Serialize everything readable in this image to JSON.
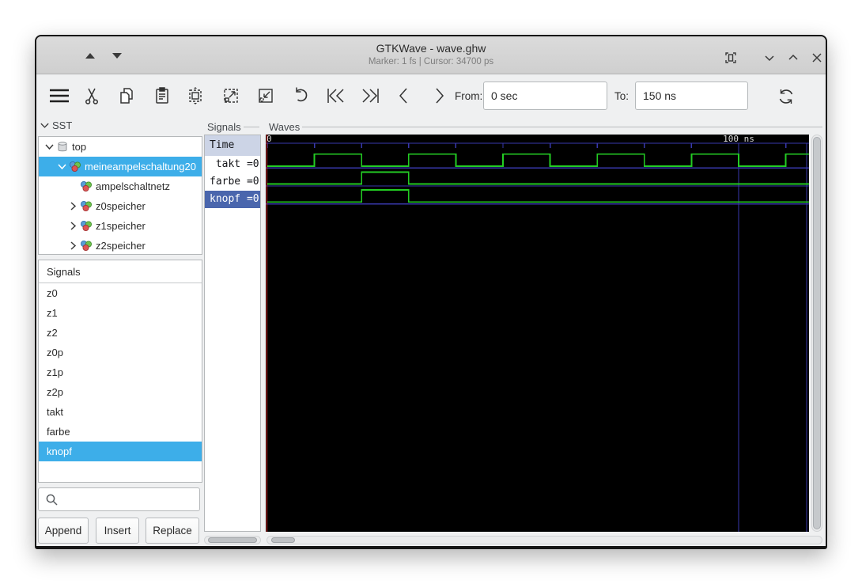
{
  "window": {
    "title": "GTKWave - wave.ghw",
    "status": "Marker: 1 fs  |  Cursor: 34700 ps"
  },
  "toolbar": {
    "from_label": "From:",
    "from_value": "0 sec",
    "to_label": "To:",
    "to_value": "150 ns"
  },
  "sst": {
    "label": "SST",
    "tree": [
      {
        "label": "top",
        "icon": "database-icon",
        "expander": "expanded",
        "depth": 0,
        "selected": false
      },
      {
        "label": "meineampelschaltung20",
        "icon": "module-icon",
        "expander": "expanded",
        "depth": 1,
        "selected": true
      },
      {
        "label": "ampelschaltnetz",
        "icon": "module-icon",
        "expander": "none",
        "depth": 2,
        "selected": false
      },
      {
        "label": "z0speicher",
        "icon": "module-icon",
        "expander": "collapsed",
        "depth": 2,
        "selected": false
      },
      {
        "label": "z1speicher",
        "icon": "module-icon",
        "expander": "collapsed",
        "depth": 2,
        "selected": false
      },
      {
        "label": "z2speicher",
        "icon": "module-icon",
        "expander": "collapsed",
        "depth": 2,
        "selected": false
      }
    ]
  },
  "signals_list": {
    "header": "Signals",
    "items": [
      {
        "label": "z0",
        "selected": false
      },
      {
        "label": "z1",
        "selected": false
      },
      {
        "label": "z2",
        "selected": false
      },
      {
        "label": "z0p",
        "selected": false
      },
      {
        "label": "z1p",
        "selected": false
      },
      {
        "label": "z2p",
        "selected": false
      },
      {
        "label": "takt",
        "selected": false
      },
      {
        "label": "farbe",
        "selected": false
      },
      {
        "label": "knopf",
        "selected": true
      }
    ]
  },
  "filter_buttons": [
    {
      "label": "Append"
    },
    {
      "label": "Insert"
    },
    {
      "label": "Replace"
    }
  ],
  "values_panel": {
    "label": "Signals",
    "header": "Time",
    "rows": [
      {
        "name": "takt",
        "display": " takt =0",
        "selected": false
      },
      {
        "name": "farbe",
        "display": "farbe =0",
        "selected": false
      },
      {
        "name": "knopf",
        "display": "knopf =0",
        "selected": true
      }
    ]
  },
  "waves_panel": {
    "label": "Waves"
  },
  "colors": {
    "selection_blue": "#3daee9",
    "selected_value_row": "#4a66ad",
    "wave_green": "#23cc23",
    "grid_blue": "#3939ac",
    "marker_red": "#d42a2a",
    "canvas_black": "#000000",
    "timeline_text": "#dcdcdc"
  },
  "chart_data": {
    "type": "digital-waveform",
    "time_unit": "ns",
    "visible_start": 0,
    "visible_end": 115,
    "tick_interval": 10,
    "tick_labels": [
      {
        "time": 0,
        "label": "0"
      },
      {
        "time": 100,
        "label": "100 ns"
      }
    ],
    "gridline_times": [
      100
    ],
    "marker_time": 0,
    "signals": [
      {
        "name": "takt",
        "initial": 0,
        "transitions": [
          10,
          20,
          30,
          40,
          50,
          60,
          70,
          80,
          90,
          100,
          110
        ]
      },
      {
        "name": "farbe",
        "initial": 0,
        "transitions": [
          20,
          30
        ]
      },
      {
        "name": "knopf",
        "initial": 0,
        "transitions": [
          20,
          30
        ]
      }
    ]
  }
}
